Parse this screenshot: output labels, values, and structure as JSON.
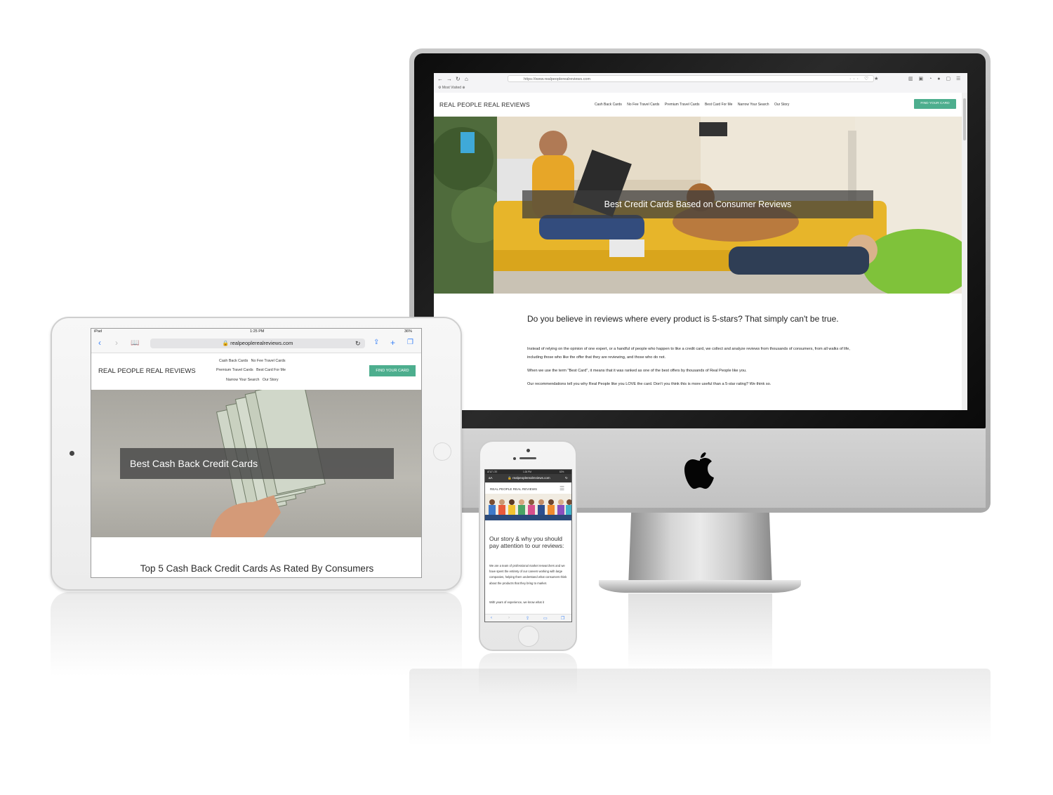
{
  "colors": {
    "accent_green": "#4dae8e",
    "hero_overlay": "#3c3c3c",
    "link_blue": "#3a82f7"
  },
  "desktop": {
    "browser": {
      "url": "https://www.realpeoplerealreviews.com",
      "bookmark": "Most Visited"
    },
    "site": {
      "logo": "REAL PEOPLE REAL REVIEWS",
      "nav": [
        "Cash Back Cards",
        "No Fee Travel Cards",
        "Premium Travel Cards",
        "Best Card For Me",
        "Narrow Your Search",
        "Our Story"
      ],
      "cta": "FIND YOUR CARD"
    },
    "hero_title": "Best Credit Cards Based on Consumer Reviews",
    "heading": "Do you believe in reviews where every product is 5-stars? That simply can't be true.",
    "paragraphs": [
      "Instead of relying on the opinion of one expert, or a handful of people who happen to like a credit card, we collect and analyze reviews from thousands of consumers, from all walks of life, including those who like the offer that they are reviewing, and those who do not.",
      "When we use the term \"Best Card\", it means that it was ranked as one of the best offers by thousands of Real People like you.",
      "Our recommendations tell you why Real People like you LOVE the card. Don't you think this is more useful than a 5-star rating? We think so."
    ]
  },
  "tablet": {
    "status": {
      "device": "iPad",
      "time": "1:25 PM",
      "battery": "36%"
    },
    "url": "realpeoplerealreviews.com",
    "site": {
      "logo": "REAL PEOPLE REAL REVIEWS",
      "nav_row1": [
        "Cash Back Cards",
        "No Fee Travel Cards"
      ],
      "nav_row2": [
        "Premium Travel Cards",
        "Best Card For Me"
      ],
      "nav_row3": [
        "Narrow Your Search",
        "Our Story"
      ],
      "cta": "FIND YOUR CARD"
    },
    "hero_title": "Best Cash Back Credit Cards",
    "heading": "Top 5 Cash Back Credit Cards As Rated By Consumers"
  },
  "phone": {
    "status": {
      "carrier": "AT&T LTE",
      "time": "1:26 PM",
      "battery": "62%"
    },
    "url_back": "aA",
    "url": "realpeoplerealreviews.com",
    "logo": "REAL PEOPLE REAL REVIEWS",
    "heading": "Our story & why you should pay attention to our reviews:",
    "paragraph": "We are a team of professional market researchers and we have spent the entirety of our careers working with large companies, helping them understand what consumers think about the products that they bring to market.",
    "paragraph2": "With years of experience, we know what it"
  }
}
